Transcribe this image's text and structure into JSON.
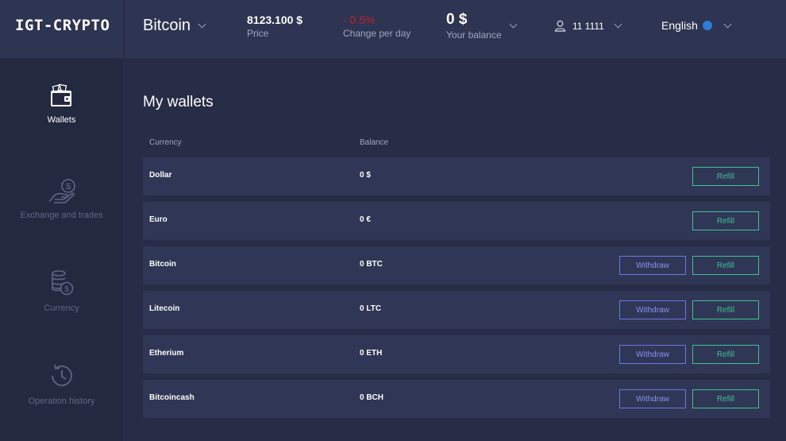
{
  "header": {
    "logo": "IGT-CRYPTO",
    "coin": "Bitcoin",
    "price_value": "8123.100 $",
    "price_label": "Price",
    "change_value": "- 0.5%",
    "change_label": "Change per day",
    "balance_value": "0 $",
    "balance_label": "Your balance",
    "user_id": "11 1111",
    "language": "English"
  },
  "sidebar": {
    "items": [
      {
        "label": "Wallets",
        "icon": "wallet-icon",
        "active": true
      },
      {
        "label": "Exchange and trades",
        "icon": "exchange-hand-icon",
        "active": false
      },
      {
        "label": "Currency",
        "icon": "coins-icon",
        "active": false
      },
      {
        "label": "Operation history",
        "icon": "history-clock-icon",
        "active": false
      }
    ]
  },
  "main": {
    "title": "My wallets",
    "columns": {
      "currency": "Currency",
      "balance": "Balance"
    },
    "buttons": {
      "withdraw": "Withdraw",
      "refill": "Refill"
    },
    "rows": [
      {
        "currency": "Dollar",
        "balance": "0 $",
        "withdraw": false
      },
      {
        "currency": "Euro",
        "balance": "0 €",
        "withdraw": false
      },
      {
        "currency": "Bitcoin",
        "balance": "0 BTC",
        "withdraw": true
      },
      {
        "currency": "Litecoin",
        "balance": "0 LTC",
        "withdraw": true
      },
      {
        "currency": "Etherium",
        "balance": "0 ETH",
        "withdraw": true
      },
      {
        "currency": "Bitcoincash",
        "balance": "0 BCH",
        "withdraw": true
      }
    ]
  },
  "colors": {
    "background": "#272d47",
    "header": "#2e3553",
    "sidebar": "#232a40",
    "row": "#2f3656",
    "refill_accent": "#3ec28f",
    "withdraw_accent": "#6d75e0",
    "change_negative": "#c3202c"
  }
}
